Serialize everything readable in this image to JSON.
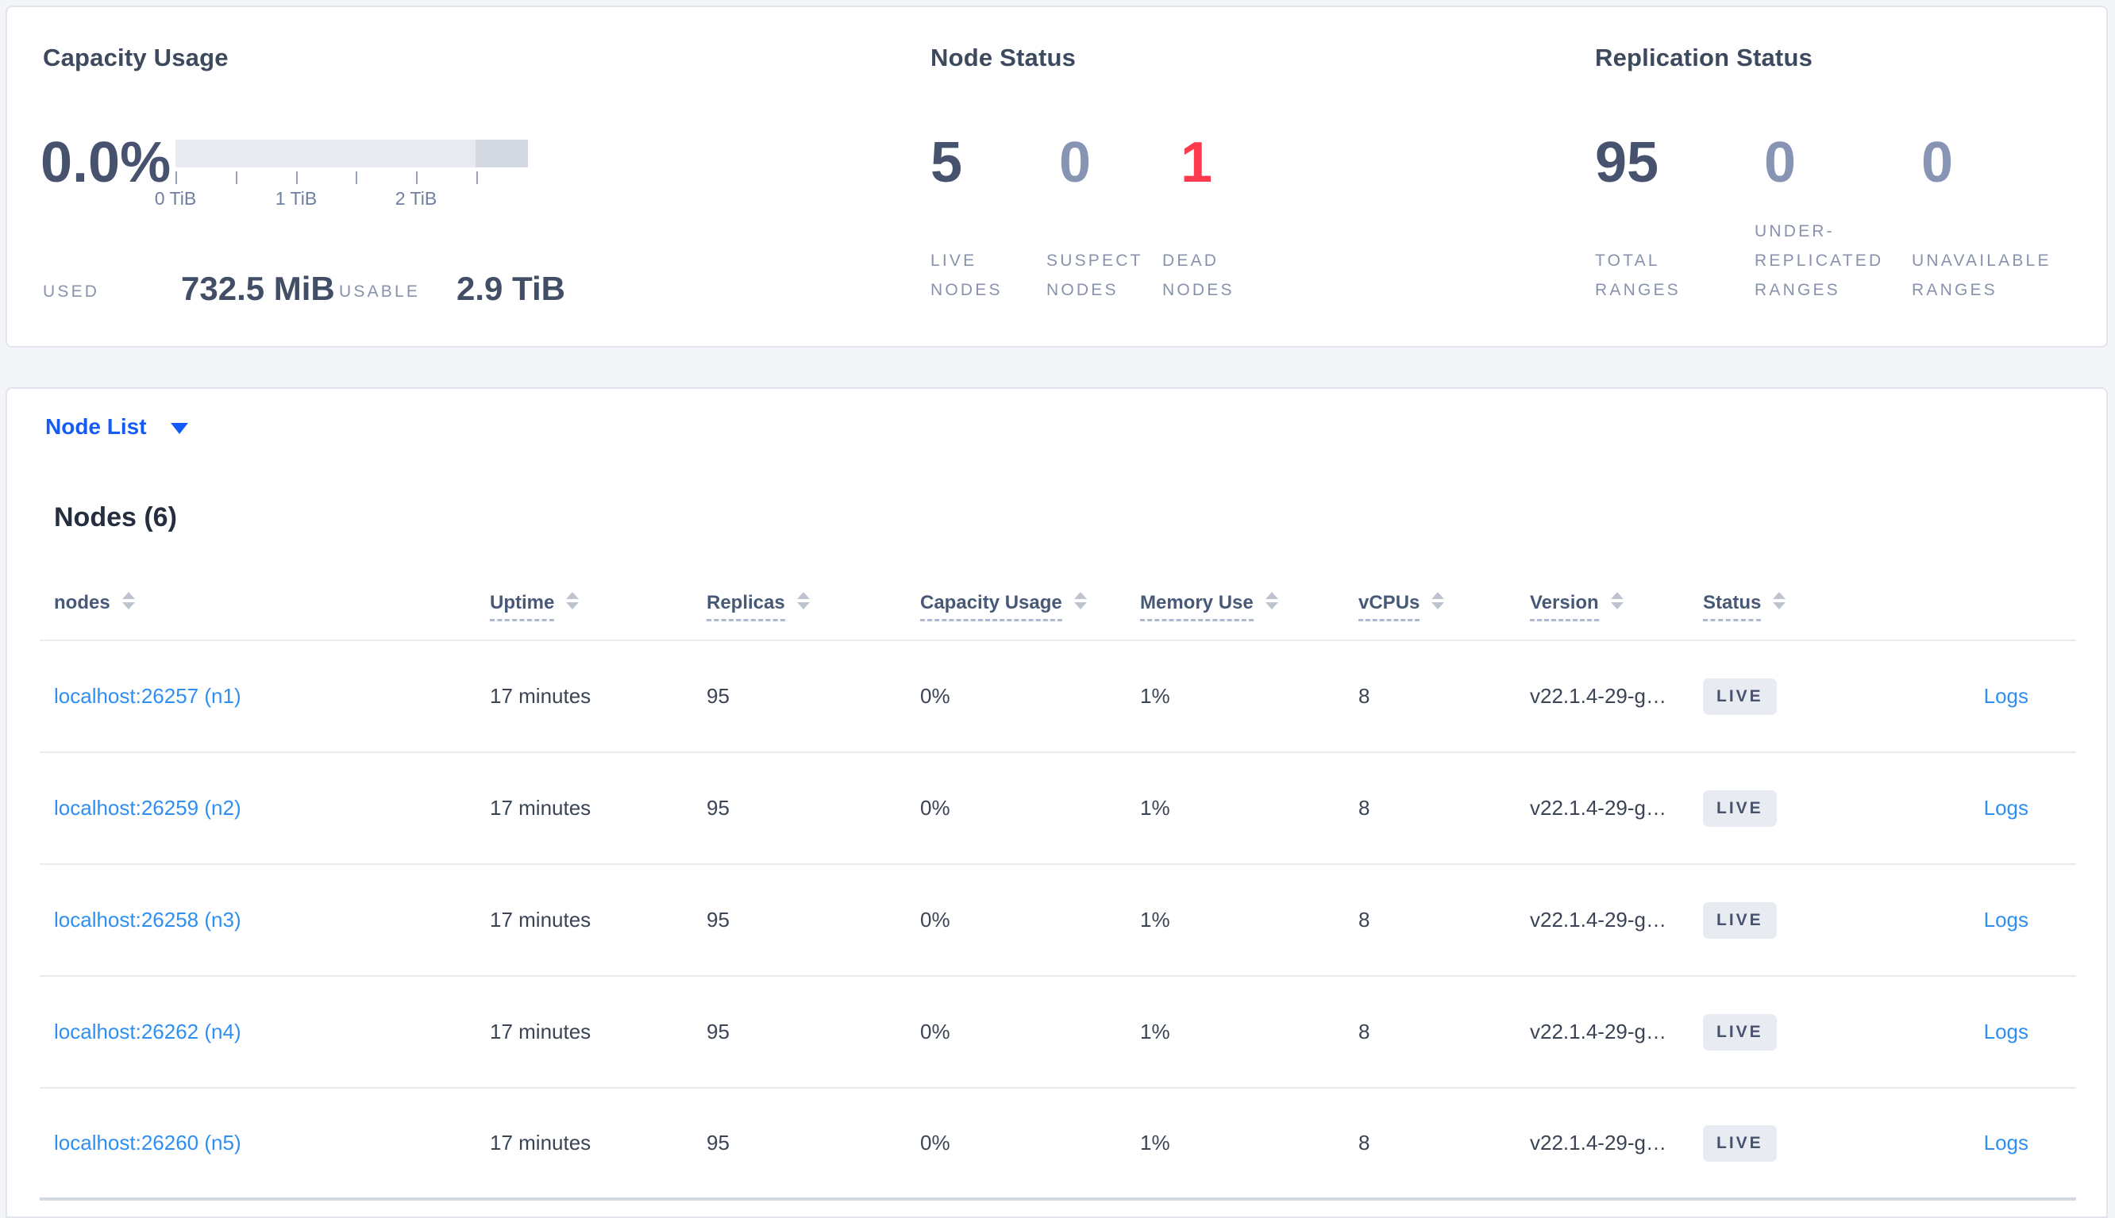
{
  "capacity": {
    "title": "Capacity Usage",
    "percent": "0.0%",
    "axis_ticks": [
      "0 TiB",
      "1 TiB",
      "2 TiB"
    ],
    "used_label": "USED",
    "used_value": "732.5 MiB",
    "usable_label": "USABLE",
    "usable_value": "2.9 TiB"
  },
  "node_status": {
    "title": "Node Status",
    "stats": [
      {
        "value": "5",
        "label": "LIVE\nNODES"
      },
      {
        "value": "0",
        "label": "SUSPECT\nNODES"
      },
      {
        "value": "1",
        "label": "DEAD\nNODES"
      }
    ]
  },
  "replication_status": {
    "title": "Replication Status",
    "stats": [
      {
        "value": "95",
        "label": "TOTAL\nRANGES"
      },
      {
        "value": "0",
        "label": "UNDER-\nREPLICATED\nRANGES"
      },
      {
        "value": "0",
        "label": "UNAVAILABLE\nRANGES"
      }
    ]
  },
  "node_list": {
    "dropdown_label": "Node List"
  },
  "nodes_table": {
    "title": "Nodes (6)",
    "columns": [
      {
        "label": "nodes"
      },
      {
        "label": "Uptime"
      },
      {
        "label": "Replicas"
      },
      {
        "label": "Capacity Usage"
      },
      {
        "label": "Memory Use"
      },
      {
        "label": "vCPUs"
      },
      {
        "label": "Version"
      },
      {
        "label": "Status"
      },
      {
        "label": ""
      }
    ],
    "rows": [
      {
        "name": "localhost:26257 (n1)",
        "uptime": "17 minutes",
        "replicas": "95",
        "capacity_usage": "0%",
        "memory_use": "1%",
        "vcpus": "8",
        "version": "v22.1.4-29-g…",
        "status": "LIVE",
        "logs_label": "Logs"
      },
      {
        "name": "localhost:26259 (n2)",
        "uptime": "17 minutes",
        "replicas": "95",
        "capacity_usage": "0%",
        "memory_use": "1%",
        "vcpus": "8",
        "version": "v22.1.4-29-g…",
        "status": "LIVE",
        "logs_label": "Logs"
      },
      {
        "name": "localhost:26258 (n3)",
        "uptime": "17 minutes",
        "replicas": "95",
        "capacity_usage": "0%",
        "memory_use": "1%",
        "vcpus": "8",
        "version": "v22.1.4-29-g…",
        "status": "LIVE",
        "logs_label": "Logs"
      },
      {
        "name": "localhost:26262 (n4)",
        "uptime": "17 minutes",
        "replicas": "95",
        "capacity_usage": "0%",
        "memory_use": "1%",
        "vcpus": "8",
        "version": "v22.1.4-29-g…",
        "status": "LIVE",
        "logs_label": "Logs"
      },
      {
        "name": "localhost:26260 (n5)",
        "uptime": "17 minutes",
        "replicas": "95",
        "capacity_usage": "0%",
        "memory_use": "1%",
        "vcpus": "8",
        "version": "v22.1.4-29-g…",
        "status": "LIVE",
        "logs_label": "Logs"
      }
    ]
  },
  "colors": {
    "page_background": "#f3f5f9",
    "card_border": "#e2e5eb",
    "stat_dark": "#47536e",
    "stat_muted": "#8794b3",
    "stat_red": "#fb3a4e",
    "label_gray": "#8893ab",
    "link_blue": "#2e8ff2",
    "dropdown_blue": "#155bf5",
    "bar_light": "#e8eaf0",
    "bar_dark": "#d5d9e2",
    "badge_bg": "#e8ebf1"
  }
}
